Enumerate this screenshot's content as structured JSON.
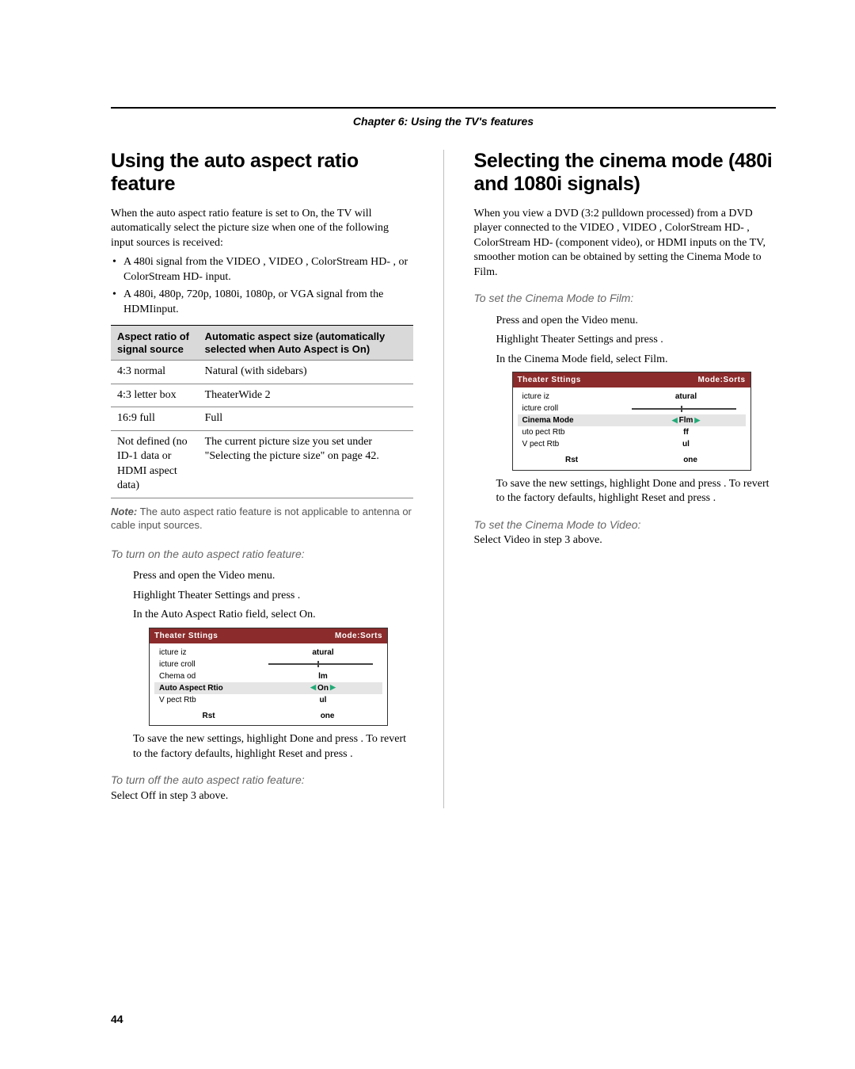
{
  "chapter": "Chapter 6: Using the TV's features",
  "page_number": "44",
  "left": {
    "h1": "Using the auto aspect ratio feature",
    "intro": "When the auto aspect ratio feature is set to On, the TV will automatically select the picture size when one of the following input sources is received:",
    "bullets": [
      "A 480i signal from the VIDEO , VIDEO , ColorStream HD- , or ColorStream HD-    input.",
      "A 480i, 480p, 720p, 1080i, 1080p, or VGA signal from the HDMIinput."
    ],
    "table": {
      "head_col1": "Aspect ratio of signal source",
      "head_col2": "Automatic aspect size (automatically selected when Auto Aspect is On)",
      "rows": [
        {
          "c1": "4:3 normal",
          "c2": "Natural (with sidebars)"
        },
        {
          "c1": "4:3 letter box",
          "c2": "TheaterWide 2"
        },
        {
          "c1": "16:9 full",
          "c2": "Full"
        },
        {
          "c1": "Not defined (no ID-1 data or HDMI aspect data)",
          "c2": "The current picture size you set under \"Selecting the picture size\" on page 42."
        }
      ]
    },
    "note_label": "Note:",
    "note_text": " The auto aspect ratio feature is not applicable to antenna or cable input sources.",
    "proc_on_head": "To turn on the auto aspect ratio feature:",
    "steps_on": [
      "Press     and open the Video menu.",
      "Highlight Theater Settings    and press    .",
      "In the Auto Aspect Ratio    field, select On."
    ],
    "osd": {
      "title_left": "Theater Sttings",
      "title_right": "Mode:Sorts",
      "rows": [
        {
          "label": "icture iz",
          "value": "atural",
          "type": "text"
        },
        {
          "label": "icture croll",
          "type": "slider"
        },
        {
          "label": "Chema od",
          "value": "lm",
          "type": "text"
        },
        {
          "label": "Auto Aspect Rtio",
          "value": "On",
          "type": "sel"
        },
        {
          "label": "V pect Rtb",
          "value": "ul",
          "type": "text"
        }
      ],
      "foot_left": "Rst",
      "foot_right": "one"
    },
    "save_text": "To save the new settings, highlight Done and press    . To revert to the factory defaults, highlight Reset and press    .",
    "proc_off_head": "To turn off the auto aspect ratio feature:",
    "off_text": "Select Off in step 3 above."
  },
  "right": {
    "h1": "Selecting the cinema mode (480i and 1080i signals)",
    "intro": "When you view a DVD (3:2 pulldown processed) from a DVD player connected to the VIDEO   , VIDEO   , ColorStream HD-  , ColorStream HD-    (component video), or HDMI inputs on the TV, smoother motion can be obtained by setting the Cinema Mode  to Film.",
    "proc_film_head": "To set the Cinema Mode to Film:",
    "steps": [
      "Press     and open the Video menu.",
      "Highlight Theater Settings    and press    .",
      "In the Cinema Mode   field, select Film."
    ],
    "osd": {
      "title_left": "Theater Sttings",
      "title_right": "Mode:Sorts",
      "rows": [
        {
          "label": "icture iz",
          "value": "atural",
          "type": "text"
        },
        {
          "label": "icture croll",
          "type": "slider"
        },
        {
          "label": "Cinema Mode",
          "value": "Flm",
          "type": "sel"
        },
        {
          "label": "uto pect Rtb",
          "value": "ff",
          "type": "text"
        },
        {
          "label": "V pect Rtb",
          "value": "ul",
          "type": "text"
        }
      ],
      "foot_left": "Rst",
      "foot_right": "one"
    },
    "save_text": "To save the new settings, highlight Done and press    . To revert to the factory defaults, highlight Reset and press    .",
    "proc_video_head": "To set the Cinema Mode to Video:",
    "video_text": "Select Video in step 3 above."
  }
}
